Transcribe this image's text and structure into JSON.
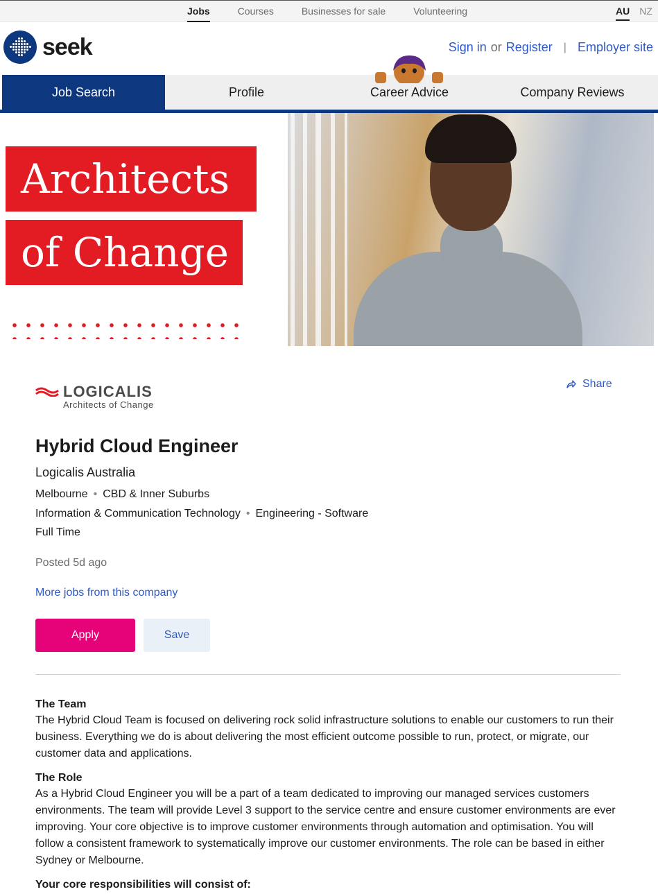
{
  "top_nav": {
    "links": [
      "Jobs",
      "Courses",
      "Businesses for sale",
      "Volunteering"
    ],
    "active": "Jobs",
    "locales": [
      "AU",
      "NZ"
    ],
    "active_locale": "AU"
  },
  "header": {
    "logo_text": "seek",
    "sign_in": "Sign in",
    "or": "or",
    "register": "Register",
    "separator": "|",
    "employer_site": "Employer site"
  },
  "main_nav": {
    "tabs": [
      "Job Search",
      "Profile",
      "Career Advice",
      "Company Reviews"
    ],
    "active": "Job Search"
  },
  "banner": {
    "line1": "Architects",
    "line2": "of Change"
  },
  "company": {
    "logo_name": "LOGICALIS",
    "logo_tagline": "Architects of Change"
  },
  "share_label": "Share",
  "job": {
    "title": "Hybrid Cloud Engineer",
    "advertiser": "Logicalis Australia",
    "location": "Melbourne",
    "area": "CBD & Inner Suburbs",
    "classification": "Information & Communication Technology",
    "subclassification": "Engineering - Software",
    "work_type": "Full Time",
    "posted": "Posted 5d ago",
    "more_jobs": "More jobs from this company",
    "bullet": "•"
  },
  "actions": {
    "apply": "Apply",
    "save": "Save"
  },
  "description": {
    "team_heading": "The Team",
    "team_body": "The Hybrid Cloud Team is focused on delivering rock solid infrastructure solutions to enable our customers to run their business. Everything we do is about delivering the most efficient outcome possible to run, protect, or migrate, our customer data and applications.",
    "role_heading": "The Role",
    "role_body": "As a Hybrid Cloud Engineer you will be a part of a team dedicated to improving our managed services customers environments. The team will provide Level 3 support to the service centre and ensure customer environments are ever improving. Your core objective is to improve customer environments through automation and optimisation. You will follow a consistent framework to systematically improve our customer environments. The role can be based in either Sydney or Melbourne.",
    "responsibilities_heading": "Your core responsibilities will consist of:"
  },
  "colors": {
    "brand_blue": "#0d3880",
    "link_blue": "#2e5ac2",
    "apply_pink": "#e60278",
    "banner_red": "#e31b23"
  },
  "icons": [
    "seek-logo-icon",
    "mascot-icon",
    "share-icon",
    "logicalis-wave-icon"
  ]
}
